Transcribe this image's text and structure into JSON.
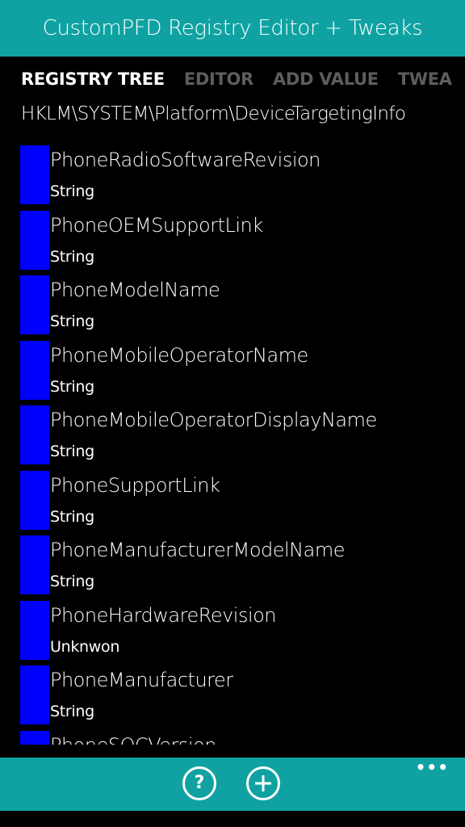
{
  "app": {
    "title": "CustomPFD Registry Editor + Tweaks"
  },
  "pivot": {
    "items": [
      {
        "label": "REGISTRY TREE",
        "active": true
      },
      {
        "label": "EDITOR",
        "active": false
      },
      {
        "label": "ADD VALUE",
        "active": false
      },
      {
        "label": "TWEA",
        "active": false
      }
    ]
  },
  "path": "HKLM\\SYSTEM\\Platform\\DeviceTargetingInfo",
  "values": [
    {
      "name": "PhoneRadioSoftwareRevision",
      "type": "String"
    },
    {
      "name": "PhoneOEMSupportLink",
      "type": "String"
    },
    {
      "name": "PhoneModelName",
      "type": "String"
    },
    {
      "name": "PhoneMobileOperatorName",
      "type": "String"
    },
    {
      "name": "PhoneMobileOperatorDisplayName",
      "type": "String"
    },
    {
      "name": "PhoneSupportLink",
      "type": "String"
    },
    {
      "name": "PhoneManufacturerModelName",
      "type": "String"
    },
    {
      "name": "PhoneHardwareRevision",
      "type": "Unknwon"
    },
    {
      "name": "PhoneManufacturer",
      "type": "String"
    },
    {
      "name": "PhoneSOCVersion",
      "type": ""
    }
  ],
  "appbar": {
    "help_icon": "help-icon",
    "add_icon": "add-icon",
    "more_label": "•••"
  },
  "colors": {
    "accent": "#10a2a2",
    "swatch": "#0000ff",
    "background": "#000000",
    "inactive_pivot": "#5d5d5d"
  }
}
